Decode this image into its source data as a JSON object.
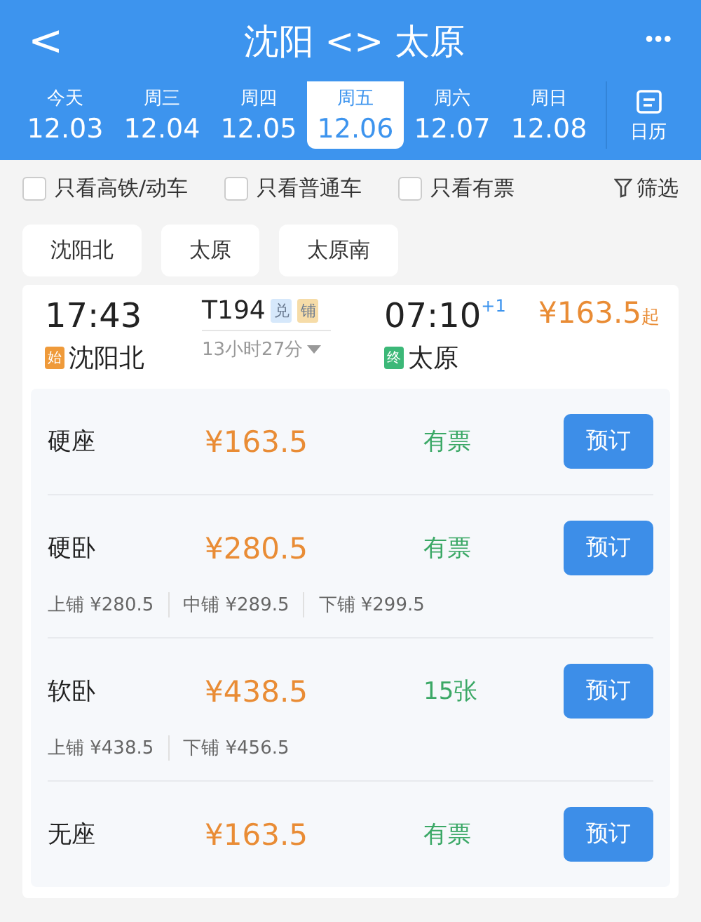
{
  "header": {
    "back": "<",
    "title": "沈阳 <> 太原",
    "more": "•••"
  },
  "dates": [
    {
      "weekday": "今天",
      "date": "12.03",
      "selected": false
    },
    {
      "weekday": "周三",
      "date": "12.04",
      "selected": false
    },
    {
      "weekday": "周四",
      "date": "12.05",
      "selected": false
    },
    {
      "weekday": "周五",
      "date": "12.06",
      "selected": true
    },
    {
      "weekday": "周六",
      "date": "12.07",
      "selected": false
    },
    {
      "weekday": "周日",
      "date": "12.08",
      "selected": false
    }
  ],
  "calendar": {
    "label": "日历"
  },
  "filters": [
    {
      "label": "只看高铁/动车",
      "checked": false
    },
    {
      "label": "只看普通车",
      "checked": false
    },
    {
      "label": "只看有票",
      "checked": false
    }
  ],
  "filter_button": "筛选",
  "stations": [
    "沈阳北",
    "太原",
    "太原南"
  ],
  "train": {
    "depart_time": "17:43",
    "depart_badge": "始",
    "depart_station": "沈阳北",
    "number": "T194",
    "tags": [
      {
        "text": "兑",
        "color": "#d6e8fb"
      },
      {
        "text": "铺",
        "color": "#f6dca8"
      }
    ],
    "duration": "13小时27分",
    "arrive_time": "07:10",
    "day_offset": "+1",
    "arrive_badge": "终",
    "arrive_station": "太原",
    "price": "¥163.5",
    "price_suffix": "起"
  },
  "seats": [
    {
      "name": "硬座",
      "price": "¥163.5",
      "availability": "有票",
      "button": "预订"
    },
    {
      "name": "硬卧",
      "price": "¥280.5",
      "availability": "有票",
      "button": "预订",
      "berths": [
        "上铺 ¥280.5",
        "中铺 ¥289.5",
        "下铺 ¥299.5"
      ]
    },
    {
      "name": "软卧",
      "price": "¥438.5",
      "availability": "15张",
      "button": "预订",
      "berths": [
        "上铺 ¥438.5",
        "下铺 ¥456.5"
      ]
    },
    {
      "name": "无座",
      "price": "¥163.5",
      "availability": "有票",
      "button": "预订"
    }
  ]
}
